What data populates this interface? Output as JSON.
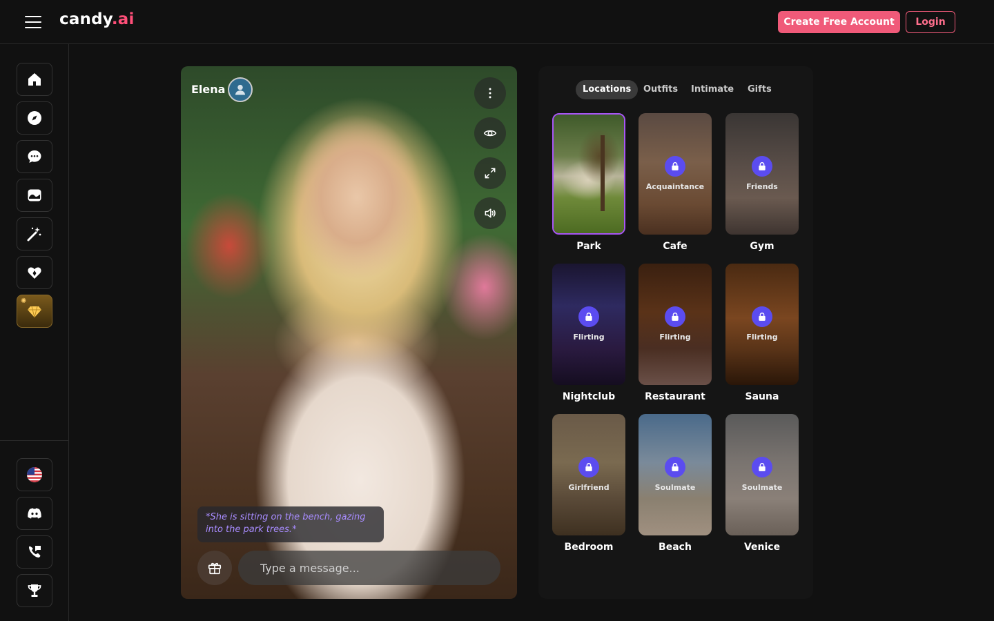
{
  "header": {
    "logo_main": "candy",
    "logo_accent": ".ai",
    "create_account_label": "Create Free Account",
    "login_label": "Login",
    "accent_color": "#f05a79"
  },
  "sidebar": {
    "top_items": [
      {
        "icon": "home-icon"
      },
      {
        "icon": "compass-icon"
      },
      {
        "icon": "chat-bubble-icon"
      },
      {
        "icon": "gallery-icon"
      },
      {
        "icon": "magic-wand-icon"
      },
      {
        "icon": "heart-icon"
      },
      {
        "icon": "diamond-icon"
      }
    ],
    "bottom_items": [
      {
        "icon": "us-flag-icon"
      },
      {
        "icon": "discord-icon"
      },
      {
        "icon": "support-icon"
      },
      {
        "icon": "trophy-icon"
      }
    ]
  },
  "character": {
    "name": "Elena",
    "narration": "*She is sitting on the bench, gazing into the park trees.*",
    "message_placeholder": "Type a message..."
  },
  "panel": {
    "tabs": [
      "Locations",
      "Outfits",
      "Intimate",
      "Gifts"
    ],
    "active_tab": "Locations",
    "tiles": [
      {
        "label": "Park",
        "tag": "",
        "locked": false,
        "selected": true
      },
      {
        "label": "Cafe",
        "tag": "Acquaintance",
        "locked": true
      },
      {
        "label": "Gym",
        "tag": "Friends",
        "locked": true
      },
      {
        "label": "Nightclub",
        "tag": "Flirting",
        "locked": true
      },
      {
        "label": "Restaurant",
        "tag": "Flirting",
        "locked": true
      },
      {
        "label": "Sauna",
        "tag": "Flirting",
        "locked": true
      },
      {
        "label": "Bedroom",
        "tag": "Girlfriend",
        "locked": true
      },
      {
        "label": "Beach",
        "tag": "Soulmate",
        "locked": true
      },
      {
        "label": "Venice",
        "tag": "Soulmate",
        "locked": true
      }
    ],
    "lock_color": "#5b4cf0",
    "selected_border_color": "#a855f7"
  }
}
